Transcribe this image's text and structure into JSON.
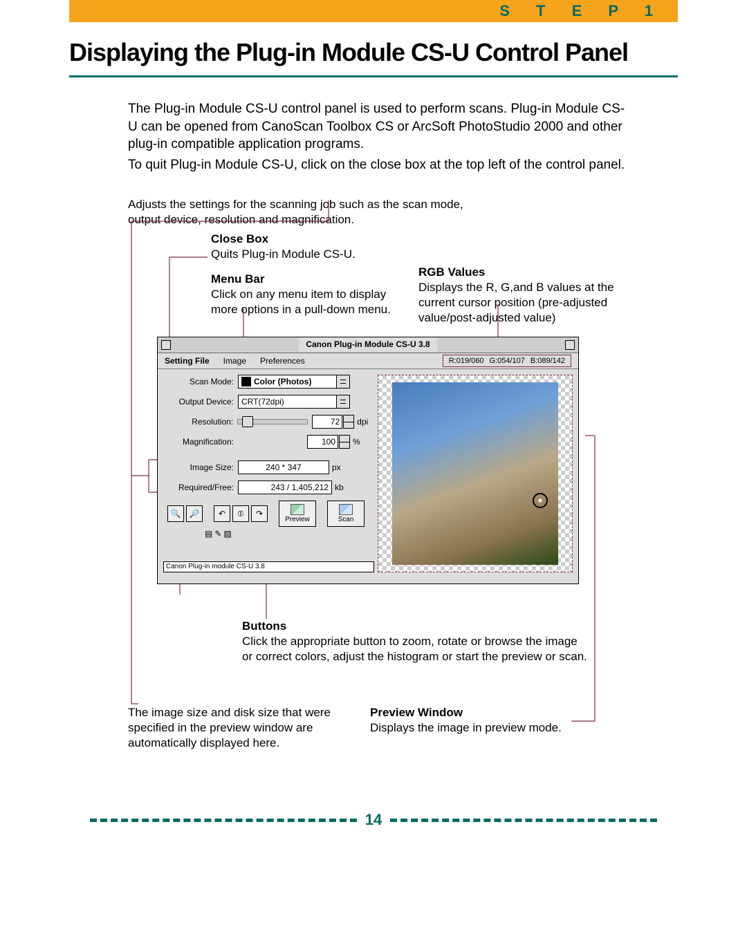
{
  "header": {
    "step_label": "S T E P   1",
    "title": "Displaying the Plug-in Module CS-U Control Panel"
  },
  "intro": {
    "p1": "The Plug-in Module CS-U control panel is used to perform scans. Plug-in Module CS-U can be opened from CanoScan Toolbox CS or ArcSoft PhotoStudio 2000 and other plug-in compatible application programs.",
    "p2": "To quit Plug-in Module CS-U, click on the close box at the top left of the control panel."
  },
  "top_caption": "Adjusts the settings for the scanning job such as the scan mode, output device, resolution and magnification.",
  "callouts": {
    "close": {
      "heading": "Close Box",
      "body": "Quits Plug-in Module CS-U."
    },
    "menu": {
      "heading": "Menu Bar",
      "body": "Click on any menu item to display more options in a pull-down menu."
    },
    "rgb": {
      "heading": "RGB Values",
      "body": "Displays the R, G,and B values at the current cursor position (pre-adjusted value/post-adjusted value)"
    },
    "buttons": {
      "heading": "Buttons",
      "body": "Click the appropriate button to zoom, rotate or browse the image or correct colors, adjust the histogram or start the preview or scan."
    },
    "imagesize": {
      "body": "The image size and disk size that were specified in the preview window are automatically displayed here."
    },
    "preview": {
      "heading": "Preview Window",
      "body": "Displays the image in preview mode."
    }
  },
  "panel": {
    "title": "Canon Plug-in Module CS-U 3.8",
    "menubar": {
      "items": [
        "Setting File",
        "Image",
        "Preferences"
      ],
      "rgb": {
        "r": "R:019/060",
        "g": "G:054/107",
        "b": "B:089/142"
      }
    },
    "fields": {
      "scan_mode": {
        "label": "Scan Mode:",
        "value": "Color (Photos)"
      },
      "output_device": {
        "label": "Output Device:",
        "value": "CRT(72dpi)"
      },
      "resolution": {
        "label": "Resolution:",
        "value": "72",
        "unit": "dpi"
      },
      "magnification": {
        "label": "Magnification:",
        "value": "100",
        "unit": "%"
      },
      "image_size": {
        "label": "Image Size:",
        "value": "240 * 347",
        "unit": "px"
      },
      "required_free": {
        "label": "Required/Free:",
        "value": "243 / 1,405,212",
        "unit": "kb"
      }
    },
    "buttons": {
      "preview": "Preview",
      "scan": "Scan"
    },
    "status": "Canon Plug-in module CS-U 3.8"
  },
  "footer": {
    "page_number": "14"
  }
}
